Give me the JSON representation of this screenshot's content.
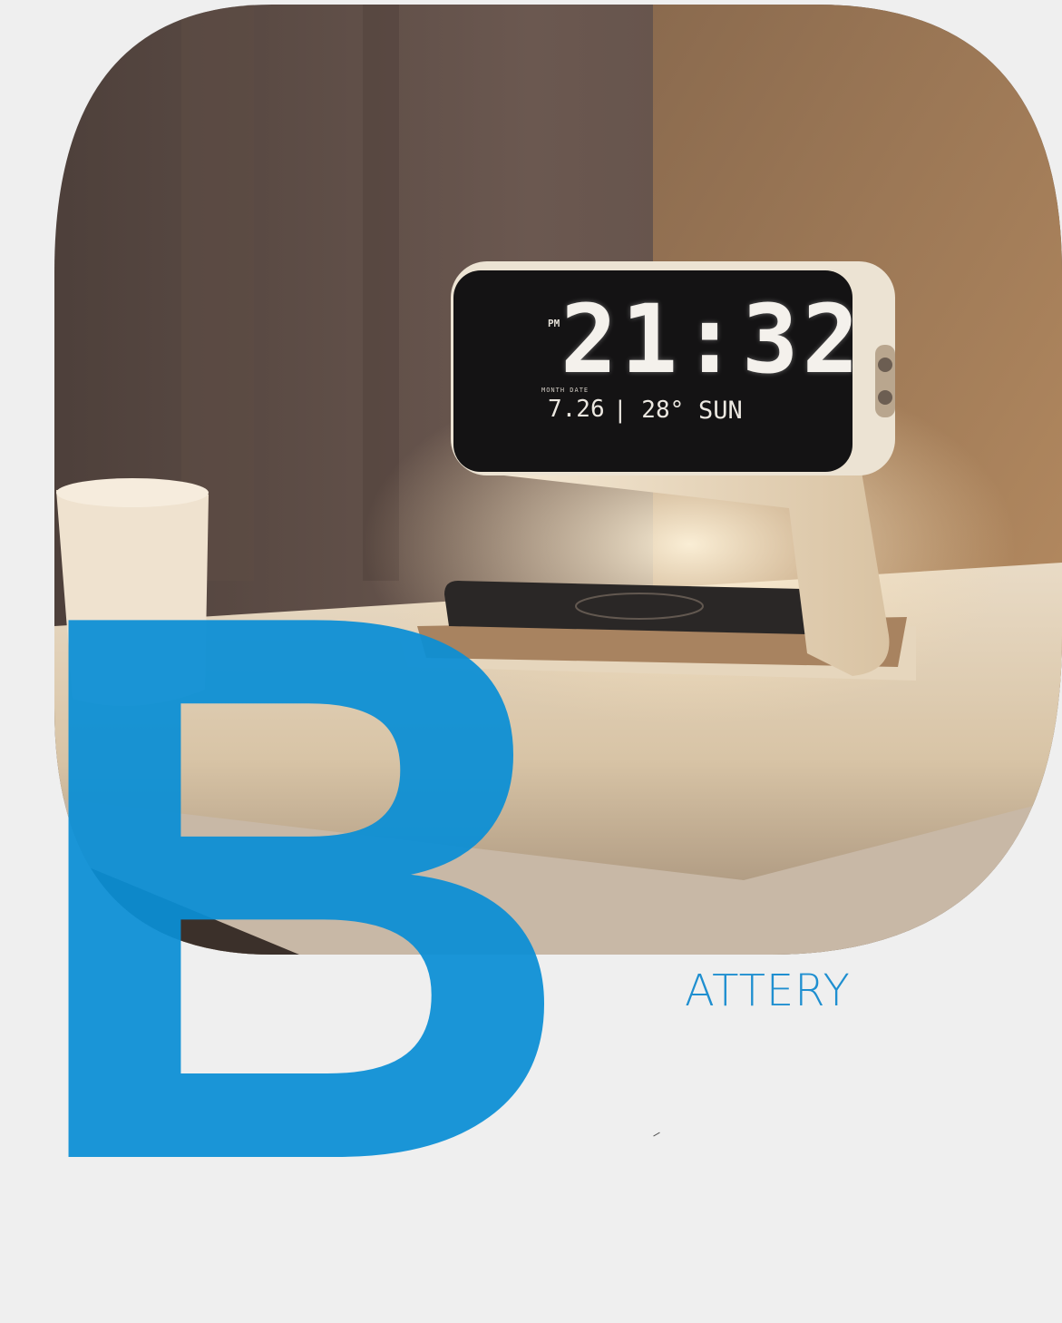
{
  "clock": {
    "ampm": "PM",
    "time": "21:32",
    "month_day_label": "MONTH  DATE",
    "date": "7.26",
    "temperature": "| 28°",
    "day": "SUN"
  },
  "heading": {
    "big_letter": "B",
    "rest": "ATTERY"
  },
  "colors": {
    "brand_blue": "#0a8fd6",
    "background": "#efefef"
  }
}
